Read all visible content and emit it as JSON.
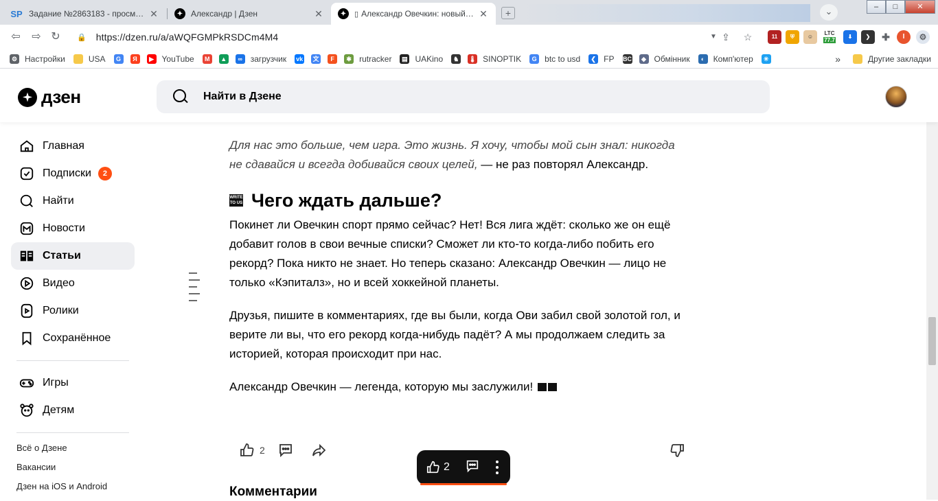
{
  "browser": {
    "tabs": [
      {
        "title": "Задание №2863183 - просмотр з",
        "favicon": "SP"
      },
      {
        "title": "Александр | Дзен",
        "favicon": "dzen"
      },
      {
        "title": "Александр Овечкин: новый ре",
        "favicon": "dzen",
        "active": true
      }
    ],
    "url": "https://dzen.ru/a/aWQFGMPkRSDCm4M4",
    "extensions": {
      "ext1_badge": "11",
      "ltc_label": "LTC",
      "ltc_value": "77.7",
      "profile_letter": "I"
    },
    "bookmarks": [
      {
        "label": "Настройки",
        "icon": "gear-icon",
        "color": "#5f6368"
      },
      {
        "label": "USA",
        "icon": "folder-icon",
        "color": "#f6c94a"
      },
      {
        "label": "",
        "icon": "google-icon",
        "color": "#4285f4"
      },
      {
        "label": "",
        "icon": "yandex-icon",
        "color": "#fc3f1d"
      },
      {
        "label": "YouTube",
        "icon": "youtube-icon",
        "color": "#ff0000"
      },
      {
        "label": "",
        "icon": "gmail-icon",
        "color": "#ea4335"
      },
      {
        "label": "",
        "icon": "drive-icon",
        "color": "#0f9d58"
      },
      {
        "label": "загрузчик",
        "icon": "infinity-icon",
        "color": "#1a73e8"
      },
      {
        "label": "",
        "icon": "vk-icon",
        "color": "#0077ff"
      },
      {
        "label": "",
        "icon": "translate-icon",
        "color": "#4285f4"
      },
      {
        "label": "",
        "icon": "f-icon",
        "color": "#f4511e"
      },
      {
        "label": "rutracker",
        "icon": "rutracker-icon",
        "color": "#6d9c3f"
      },
      {
        "label": "UAKino",
        "icon": "uakino-icon",
        "color": "#222222"
      },
      {
        "label": "",
        "icon": "chess-icon",
        "color": "#333333"
      },
      {
        "label": "SINOPTIK",
        "icon": "thermometer-icon",
        "color": "#d93025"
      },
      {
        "label": "btc to usd",
        "icon": "google-icon",
        "color": "#4285f4"
      },
      {
        "label": "FP",
        "icon": "fp-icon",
        "color": "#1a73e8"
      },
      {
        "label": "",
        "icon": "bc-icon",
        "color": "#333333"
      },
      {
        "label": "Обмінник",
        "icon": "exchange-icon",
        "color": "#5f6b8a"
      },
      {
        "label": "Комп'ютер",
        "icon": "computer-icon",
        "color": "#2b6cb0"
      },
      {
        "label": "",
        "icon": "walmart-icon",
        "color": "#1da1f2"
      }
    ],
    "more_bookmarks": "»",
    "other_bookmarks": "Другие закладки"
  },
  "header": {
    "logo_text": "дзен",
    "search_placeholder": "Найти в Дзене"
  },
  "sidebar": {
    "items": [
      {
        "label": "Главная",
        "icon": "home-icon"
      },
      {
        "label": "Подписки",
        "icon": "subscriptions-icon",
        "badge": "2"
      },
      {
        "label": "Найти",
        "icon": "search-icon"
      },
      {
        "label": "Новости",
        "icon": "news-icon"
      },
      {
        "label": "Статьи",
        "icon": "articles-icon",
        "active": true
      },
      {
        "label": "Видео",
        "icon": "video-icon"
      },
      {
        "label": "Ролики",
        "icon": "shorts-icon"
      },
      {
        "label": "Сохранённое",
        "icon": "bookmark-icon"
      }
    ],
    "items2": [
      {
        "label": "Игры",
        "icon": "gamepad-icon"
      },
      {
        "label": "Детям",
        "icon": "kids-icon"
      }
    ],
    "footer": [
      "Всё о Дзене",
      "Вакансии",
      "Дзен на iOS и Android"
    ]
  },
  "article": {
    "quote_italic": "Для нас это больше, чем игра. Это жизнь. Я хочу, чтобы мой сын знал: никогда не сдавайся и всегда добивайся своих целей,",
    "quote_tail": " — не раз повторял Александр.",
    "heading": "Чего ждать дальше?",
    "heading_emoji_text": "WRITE TO US",
    "p1": "Покинет ли Овечкин спорт прямо сейчас? Нет! Вся лига ждёт: сколько же он ещё добавит голов в свои вечные списки? Сможет ли кто-то когда-либо побить его рекорд? Пока никто не знает. Но теперь сказано: Александр Овечкин — лицо не только «Кэпиталз», но и всей хоккейной планеты.",
    "p2": "Друзья, пишите в комментариях, где вы были, когда Ови забил свой золотой гол, и верите ли вы, что его рекорд когда-нибудь падёт? А мы продолжаем следить за историей, которая происходит при нас.",
    "p3": "Александр Овечкин — легенда, которую мы заслужили!"
  },
  "actions": {
    "likes": "2"
  },
  "floatbar": {
    "likes": "2"
  },
  "comments_title": "Комментарии",
  "colors": {
    "accent": "#ff4f12",
    "active_bg": "#eeeff2",
    "search_bg": "#f0f1f4"
  }
}
